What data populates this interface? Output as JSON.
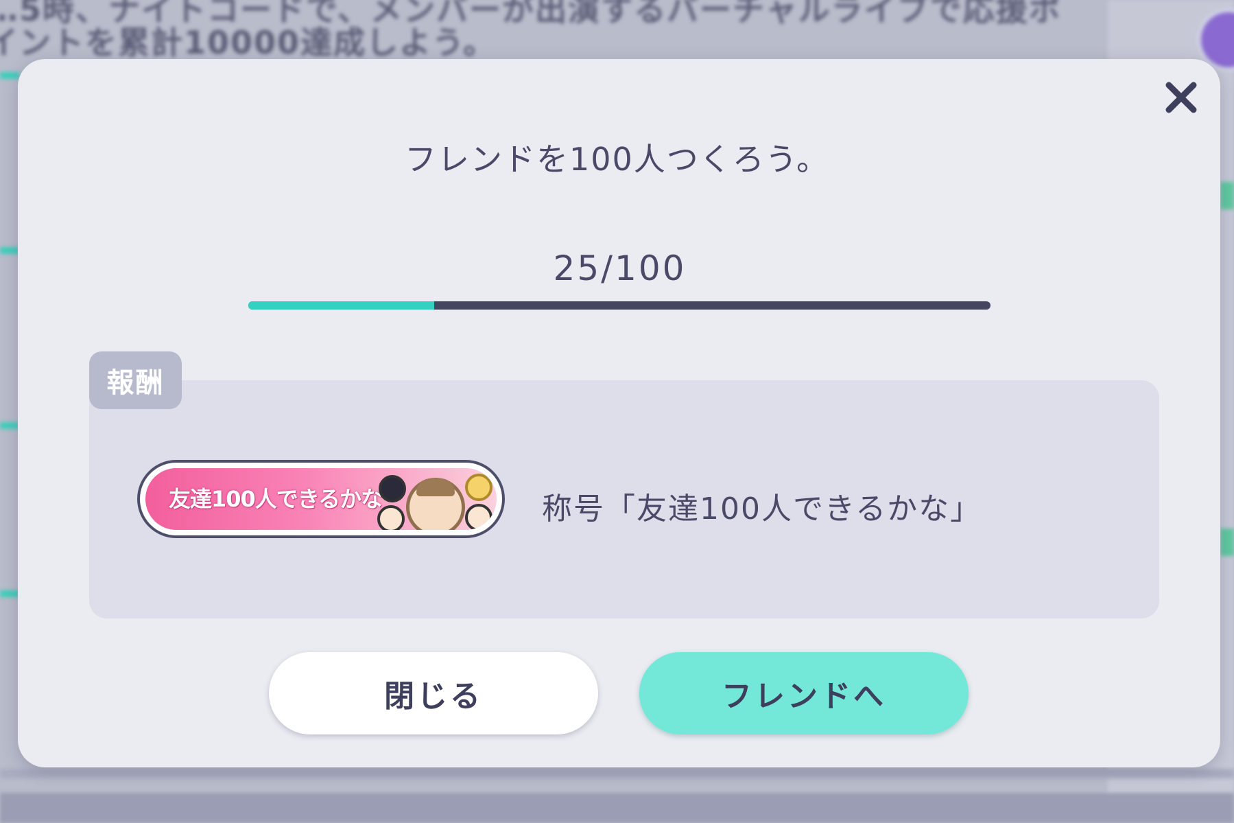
{
  "background": {
    "line1": "…5時、ナイトコードで、メンバーが出演するバーチャルライブで応援ポ",
    "line2": "イントを累計10000達成しよう。"
  },
  "modal": {
    "close_icon": "close-icon",
    "mission_title": "フレンドを100人つくろう。",
    "progress": {
      "current": 25,
      "total": 100,
      "label": "25/100",
      "fill_color": "#33d1c0",
      "track_color": "#44465f"
    },
    "reward": {
      "tag_label": "報酬",
      "badge_text": "友達100人できるかな",
      "name": "称号「友達100人できるかな」"
    },
    "buttons": {
      "close_label": "閉じる",
      "friend_label": "フレンドへ"
    }
  },
  "colors": {
    "accent": "#74e8d8",
    "text": "#4a4a68",
    "modal_bg": "#ebecf2",
    "panel_bg": "#dddeea"
  }
}
